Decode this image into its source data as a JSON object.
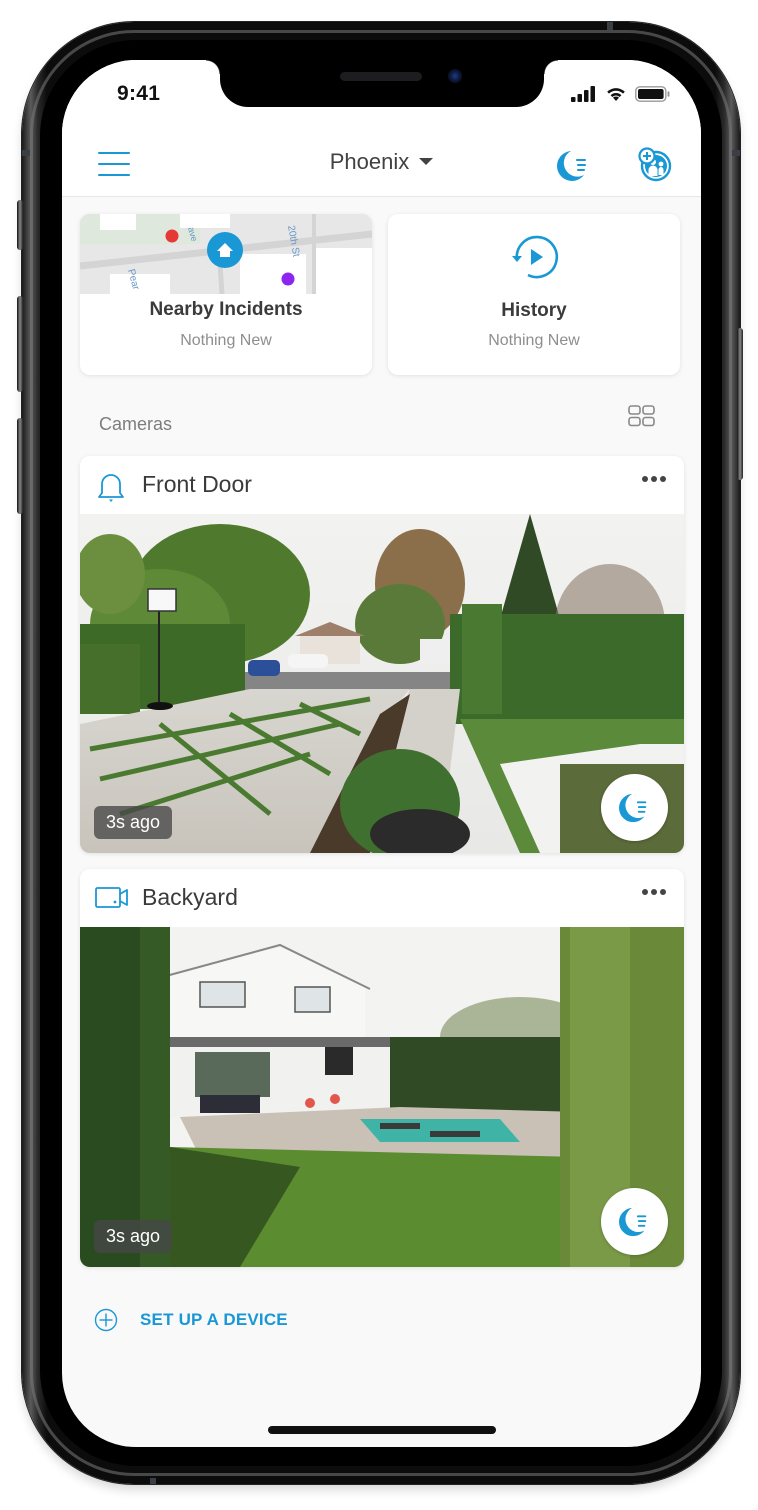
{
  "status_bar": {
    "time": "9:41",
    "icons": [
      "signal-icon",
      "wifi-icon",
      "battery-icon"
    ]
  },
  "header": {
    "menu_icon": "hamburger-menu-icon",
    "location": "Phoenix",
    "location_dropdown_icon": "caret-down-icon",
    "mode_icon": "moon-mode-icon",
    "shared_users_icon": "shared-users-add-icon"
  },
  "tiles": [
    {
      "title": "Nearby Incidents",
      "subtitle": "Nothing New",
      "map_labels": [
        "ave",
        "20th St",
        "Pear"
      ]
    },
    {
      "title": "History",
      "subtitle": "Nothing New",
      "icon": "history-play-icon"
    }
  ],
  "cameras_section": {
    "label": "Cameras",
    "view_toggle_icon": "grid-view-icon"
  },
  "cameras": [
    {
      "name": "Front Door",
      "device_icon": "doorbell-icon",
      "last_update": "3s ago",
      "feed_scene": "front yard driveway with basketball hoop",
      "mode_icon": "moon-mode-icon"
    },
    {
      "name": "Backyard",
      "device_icon": "camera-icon",
      "last_update": "3s ago",
      "feed_scene": "backyard with house, lawn and pool",
      "mode_icon": "moon-mode-icon"
    }
  ],
  "setup_device": {
    "label": "SET UP A DEVICE",
    "icon": "plus-circle-icon"
  },
  "colors": {
    "accent": "#1998d5",
    "background": "#f9f9f9",
    "card": "#ffffff",
    "text_primary": "#3a3a3a",
    "text_secondary": "#8e8e8e",
    "incident_red": "#e53935",
    "incident_purple": "#8e24f0"
  }
}
